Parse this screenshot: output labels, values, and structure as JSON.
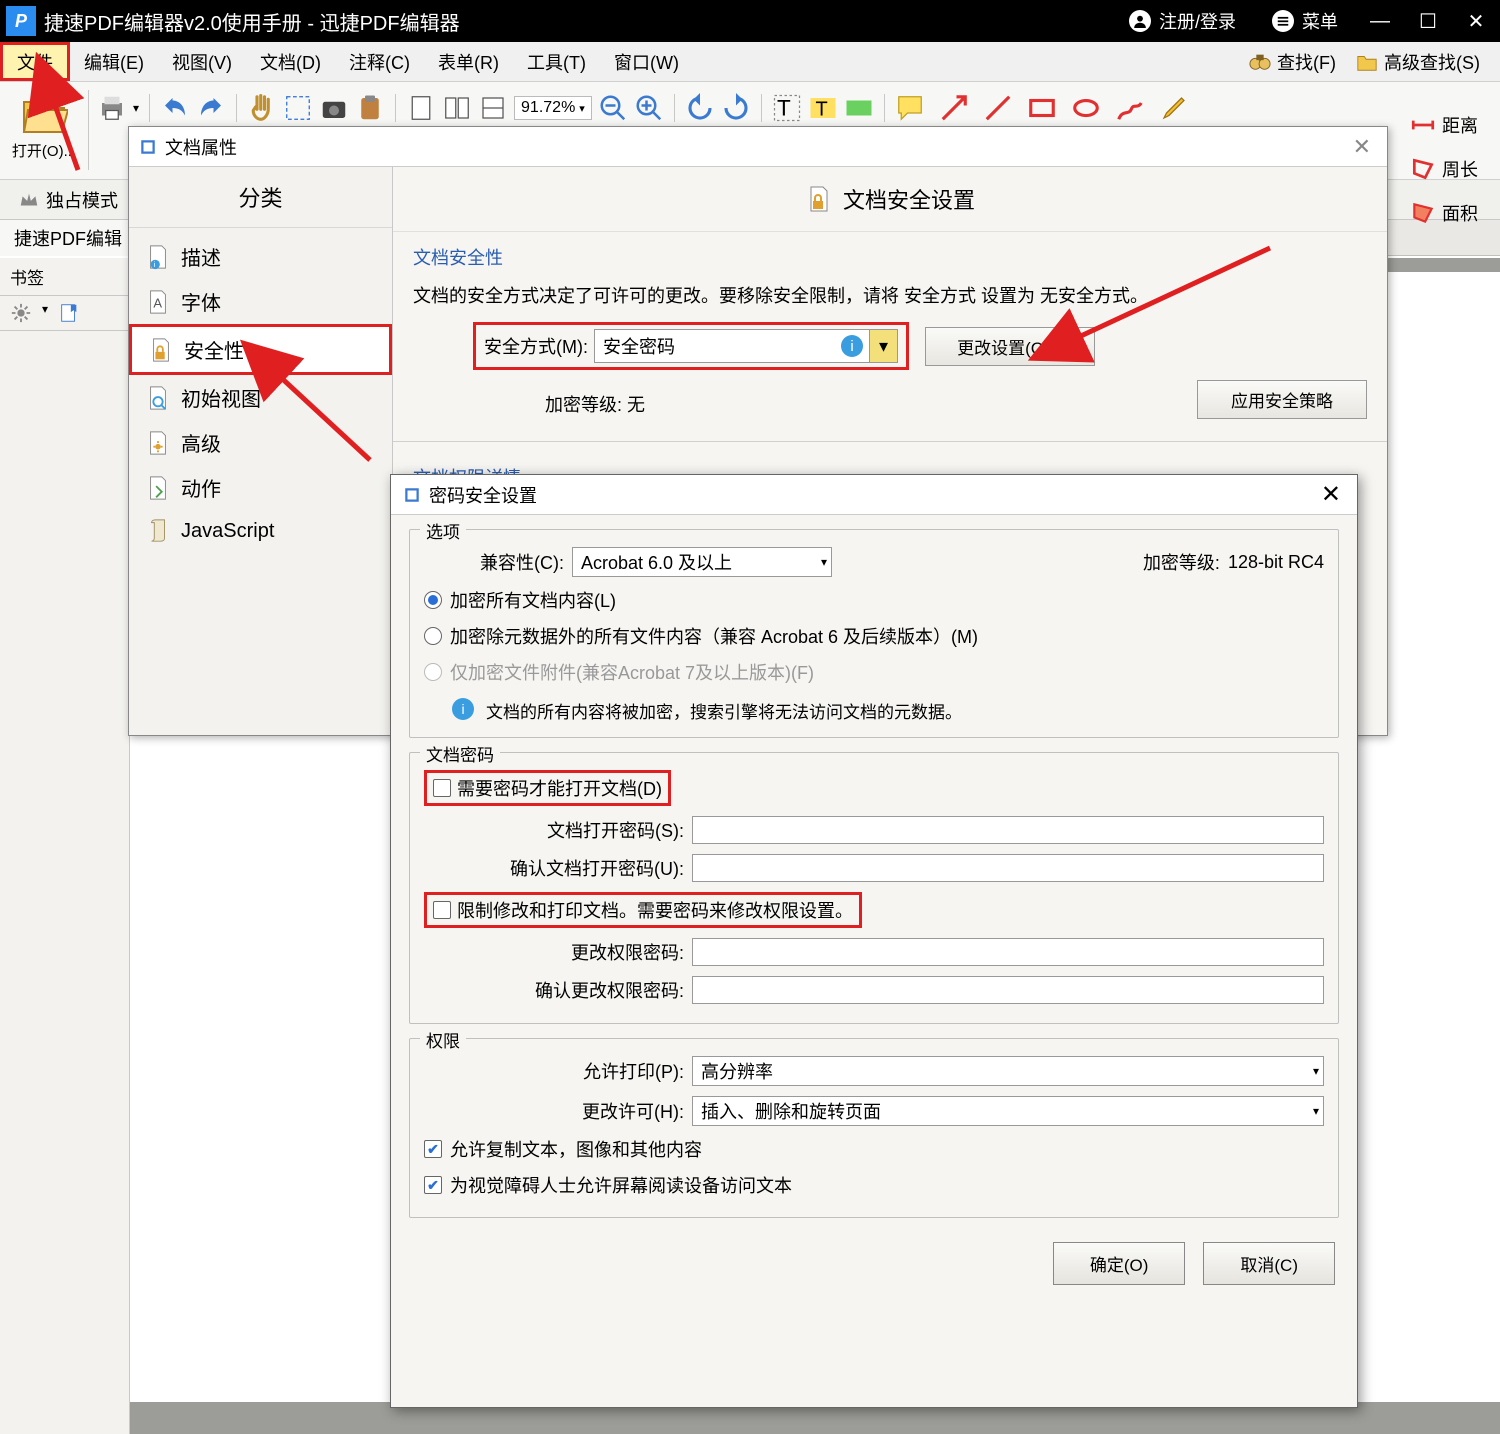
{
  "titlebar": {
    "title": "捷速PDF编辑器v2.0使用手册  -  迅捷PDF编辑器",
    "login": "注册/登录",
    "menu": "菜单"
  },
  "menubar": {
    "items": [
      "文件",
      "编辑(E)",
      "视图(V)",
      "文档(D)",
      "注释(C)",
      "表单(R)",
      "工具(T)",
      "窗口(W)"
    ],
    "find": "查找(F)",
    "adv_find": "高级查找(S)"
  },
  "toolbar": {
    "open": "打开(O)...",
    "zoom": "91.72%"
  },
  "ribbon2": {
    "exclusive": "独占模式"
  },
  "right_tools": {
    "distance": "距离",
    "perimeter": "周长",
    "area": "面积"
  },
  "tab": {
    "name": "捷速PDF编辑"
  },
  "left_panel": {
    "title": "书签"
  },
  "dlg1": {
    "title": "文档属性",
    "sidebar_header": "分类",
    "sidebar_items": [
      "描述",
      "字体",
      "安全性",
      "初始视图",
      "高级",
      "动作",
      "JavaScript"
    ],
    "content_header": "文档安全设置",
    "group1_title": "文档安全性",
    "group1_msg": "文档的安全方式决定了可许可的更改。要移除安全限制，请将 安全方式 设置为 无安全方式。",
    "sec_method_label": "安全方式(M):",
    "sec_method_value": "安全密码",
    "change_settings": "更改设置(C)...",
    "enc_level_label": "加密等级:",
    "enc_level_value": "无",
    "apply_policy": "应用安全策略",
    "group2_title": "文档权限详情"
  },
  "dlg2": {
    "title": "密码安全设置",
    "options_legend": "选项",
    "compat_label": "兼容性(C):",
    "compat_value": "Acrobat 6.0 及以上",
    "enc_level_label": "加密等级:",
    "enc_level_value": "128-bit RC4",
    "radio1": "加密所有文档内容(L)",
    "radio2": "加密除元数据外的所有文件内容（兼容 Acrobat 6 及后续版本）(M)",
    "radio3": "仅加密文件附件(兼容Acrobat 7及以上版本)(F)",
    "info1": "文档的所有内容将被加密，搜索引擎将无法访问文档的元数据。",
    "pwd_legend": "文档密码",
    "need_open_pwd": "需要密码才能打开文档(D)",
    "open_pwd_label": "文档打开密码(S):",
    "open_pwd_confirm": "确认文档打开密码(U):",
    "restrict": "限制修改和打印文档。需要密码来修改权限设置。",
    "perm_pwd_label": "更改权限密码:",
    "perm_pwd_confirm": "确认更改权限密码:",
    "perm_legend": "权限",
    "allow_print_label": "允许打印(P):",
    "allow_print_value": "高分辨率",
    "allow_change_label": "更改许可(H):",
    "allow_change_value": "插入、删除和旋转页面",
    "allow_copy": "允许复制文本，图像和其他内容",
    "allow_screen": "为视觉障碍人士允许屏幕阅读设备访问文本",
    "ok": "确定(O)",
    "cancel": "取消(C)"
  }
}
